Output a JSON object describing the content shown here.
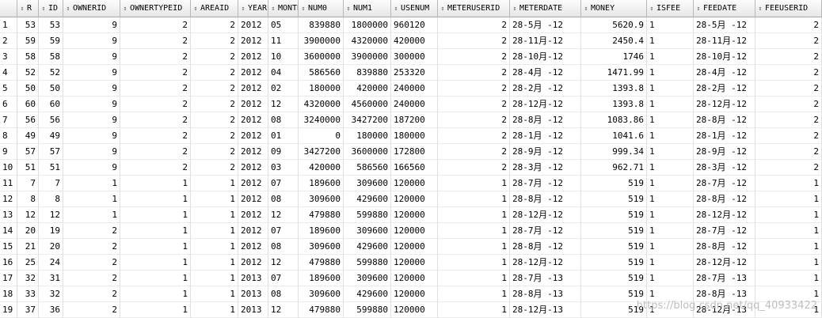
{
  "columns": [
    "R",
    "ID",
    "OWNERID",
    "OWNERTYPEID",
    "AREAID",
    "YEAR",
    "MONTH",
    "NUM0",
    "NUM1",
    "USENUM",
    "METERUSERID",
    "METERDATE",
    "MONEY",
    "ISFEE",
    "FEEDATE",
    "FEEUSERID"
  ],
  "row_numbers": [
    "1",
    "2",
    "3",
    "4",
    "5",
    "6",
    "7",
    "8",
    "9",
    "10",
    "11",
    "12",
    "13",
    "14",
    "15",
    "16",
    "17",
    "18",
    "19"
  ],
  "rows": [
    [
      "53",
      "53",
      "9",
      "2",
      "2",
      "2012",
      "05",
      "839880",
      "1800000",
      "960120",
      "2",
      "28-5月 -12",
      "5620.9",
      "1",
      "28-5月 -12",
      "2"
    ],
    [
      "59",
      "59",
      "9",
      "2",
      "2",
      "2012",
      "11",
      "3900000",
      "4320000",
      "420000",
      "2",
      "28-11月-12",
      "2450.4",
      "1",
      "28-11月-12",
      "2"
    ],
    [
      "58",
      "58",
      "9",
      "2",
      "2",
      "2012",
      "10",
      "3600000",
      "3900000",
      "300000",
      "2",
      "28-10月-12",
      "1746",
      "1",
      "28-10月-12",
      "2"
    ],
    [
      "52",
      "52",
      "9",
      "2",
      "2",
      "2012",
      "04",
      "586560",
      "839880",
      "253320",
      "2",
      "28-4月 -12",
      "1471.99",
      "1",
      "28-4月 -12",
      "2"
    ],
    [
      "50",
      "50",
      "9",
      "2",
      "2",
      "2012",
      "02",
      "180000",
      "420000",
      "240000",
      "2",
      "28-2月 -12",
      "1393.8",
      "1",
      "28-2月 -12",
      "2"
    ],
    [
      "60",
      "60",
      "9",
      "2",
      "2",
      "2012",
      "12",
      "4320000",
      "4560000",
      "240000",
      "2",
      "28-12月-12",
      "1393.8",
      "1",
      "28-12月-12",
      "2"
    ],
    [
      "56",
      "56",
      "9",
      "2",
      "2",
      "2012",
      "08",
      "3240000",
      "3427200",
      "187200",
      "2",
      "28-8月 -12",
      "1083.86",
      "1",
      "28-8月 -12",
      "2"
    ],
    [
      "49",
      "49",
      "9",
      "2",
      "2",
      "2012",
      "01",
      "0",
      "180000",
      "180000",
      "2",
      "28-1月 -12",
      "1041.6",
      "1",
      "28-1月 -12",
      "2"
    ],
    [
      "57",
      "57",
      "9",
      "2",
      "2",
      "2012",
      "09",
      "3427200",
      "3600000",
      "172800",
      "2",
      "28-9月 -12",
      "999.34",
      "1",
      "28-9月 -12",
      "2"
    ],
    [
      "51",
      "51",
      "9",
      "2",
      "2",
      "2012",
      "03",
      "420000",
      "586560",
      "166560",
      "2",
      "28-3月 -12",
      "962.71",
      "1",
      "28-3月 -12",
      "2"
    ],
    [
      "7",
      "7",
      "1",
      "1",
      "1",
      "2012",
      "07",
      "189600",
      "309600",
      "120000",
      "1",
      "28-7月 -12",
      "519",
      "1",
      "28-7月 -12",
      "1"
    ],
    [
      "8",
      "8",
      "1",
      "1",
      "1",
      "2012",
      "08",
      "309600",
      "429600",
      "120000",
      "1",
      "28-8月 -12",
      "519",
      "1",
      "28-8月 -12",
      "1"
    ],
    [
      "12",
      "12",
      "1",
      "1",
      "1",
      "2012",
      "12",
      "479880",
      "599880",
      "120000",
      "1",
      "28-12月-12",
      "519",
      "1",
      "28-12月-12",
      "1"
    ],
    [
      "20",
      "19",
      "2",
      "1",
      "1",
      "2012",
      "07",
      "189600",
      "309600",
      "120000",
      "1",
      "28-7月 -12",
      "519",
      "1",
      "28-7月 -12",
      "1"
    ],
    [
      "21",
      "20",
      "2",
      "1",
      "1",
      "2012",
      "08",
      "309600",
      "429600",
      "120000",
      "1",
      "28-8月 -12",
      "519",
      "1",
      "28-8月 -12",
      "1"
    ],
    [
      "25",
      "24",
      "2",
      "1",
      "1",
      "2012",
      "12",
      "479880",
      "599880",
      "120000",
      "1",
      "28-12月-12",
      "519",
      "1",
      "28-12月-12",
      "1"
    ],
    [
      "32",
      "31",
      "2",
      "1",
      "1",
      "2013",
      "07",
      "189600",
      "309600",
      "120000",
      "1",
      "28-7月 -13",
      "519",
      "1",
      "28-7月 -13",
      "1"
    ],
    [
      "33",
      "32",
      "2",
      "1",
      "1",
      "2013",
      "08",
      "309600",
      "429600",
      "120000",
      "1",
      "28-8月 -13",
      "519",
      "1",
      "28-8月 -13",
      "1"
    ],
    [
      "37",
      "36",
      "2",
      "1",
      "1",
      "2013",
      "12",
      "479880",
      "599880",
      "120000",
      "1",
      "28-12月-13",
      "519",
      "1",
      "28-12月-13",
      "1"
    ]
  ],
  "sort_icon": "sort-arrows-icon",
  "watermark": "https://blog.csdn.net/qq_40933422"
}
